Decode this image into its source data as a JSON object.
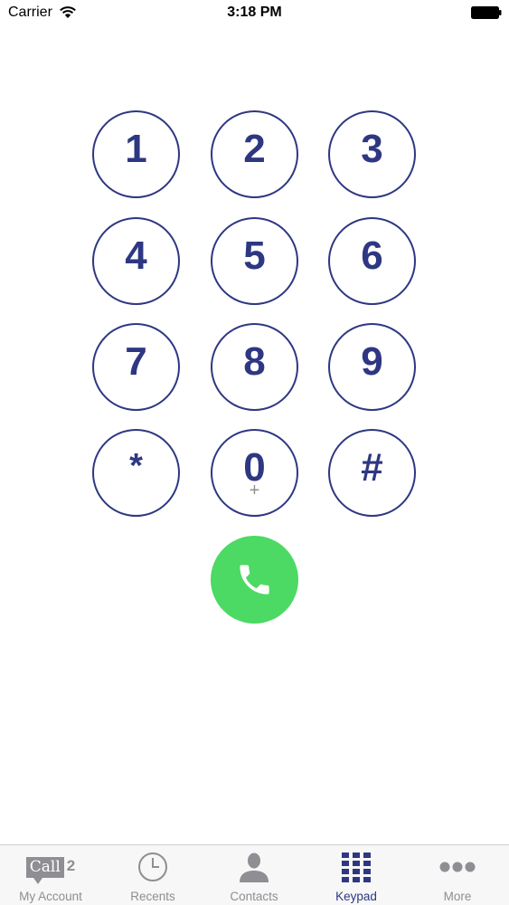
{
  "status_bar": {
    "carrier": "Carrier",
    "time": "3:18 PM",
    "icons": [
      "wifi-icon",
      "battery-icon"
    ]
  },
  "keypad": {
    "keys": [
      {
        "digit": "1",
        "sub": ""
      },
      {
        "digit": "2",
        "sub": ""
      },
      {
        "digit": "3",
        "sub": ""
      },
      {
        "digit": "4",
        "sub": ""
      },
      {
        "digit": "5",
        "sub": ""
      },
      {
        "digit": "6",
        "sub": ""
      },
      {
        "digit": "7",
        "sub": ""
      },
      {
        "digit": "8",
        "sub": ""
      },
      {
        "digit": "9",
        "sub": ""
      },
      {
        "digit": "*",
        "sub": ""
      },
      {
        "digit": "0",
        "sub": "+"
      },
      {
        "digit": "#",
        "sub": ""
      }
    ],
    "call_icon": "phone-icon"
  },
  "tab_bar": {
    "active_tab": "Keypad",
    "tabs": [
      {
        "label": "My Account",
        "icon": "call2-logo-icon",
        "logo_text": "Call",
        "logo_num": "2"
      },
      {
        "label": "Recents",
        "icon": "clock-icon"
      },
      {
        "label": "Contacts",
        "icon": "person-icon"
      },
      {
        "label": "Keypad",
        "icon": "keypad-grid-icon"
      },
      {
        "label": "More",
        "icon": "more-dots-icon"
      }
    ]
  },
  "colors": {
    "keypad_blue": "#2e3782",
    "call_green": "#4cd964",
    "tab_inactive": "#8e8e93",
    "tab_bar_bg": "#f7f7f7"
  }
}
